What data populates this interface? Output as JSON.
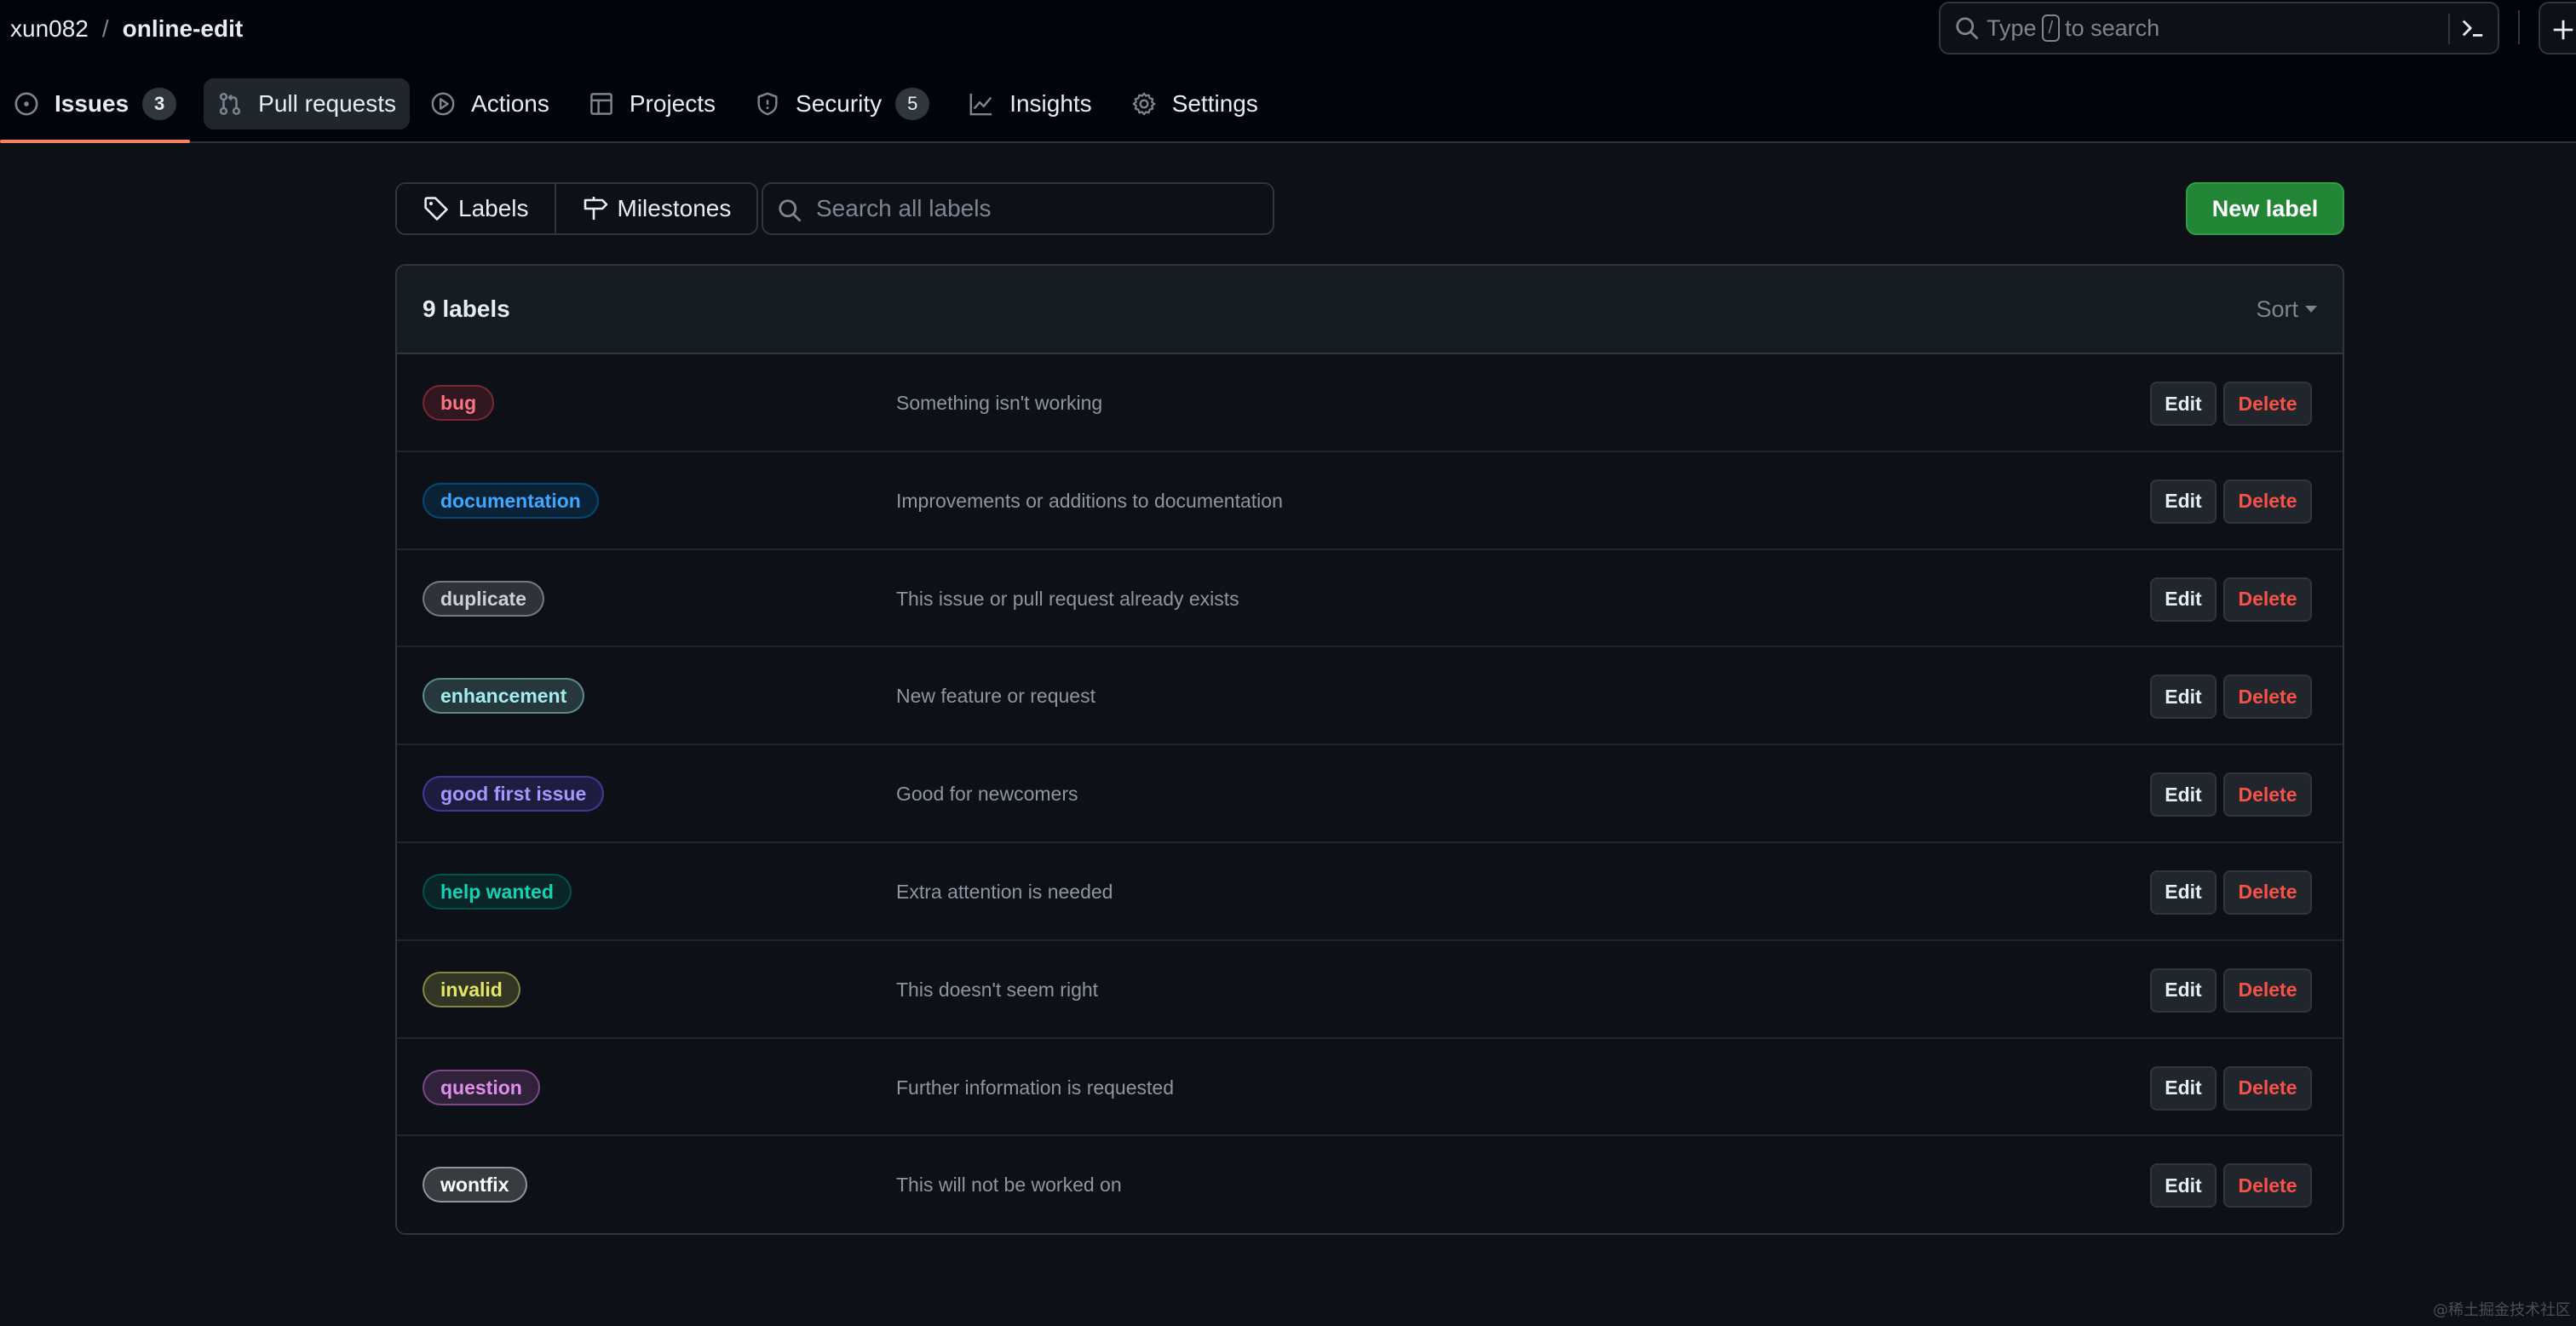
{
  "breadcrumb": {
    "owner": "xun082",
    "separator": "/",
    "repo": "online-edit"
  },
  "global_search": {
    "prefix": "Type",
    "key": "/",
    "suffix": "to search"
  },
  "tabs": [
    {
      "label": "Issues",
      "count": "3",
      "icon": "issue-opened-icon"
    },
    {
      "label": "Pull requests",
      "icon": "git-pull-request-icon"
    },
    {
      "label": "Actions",
      "icon": "play-icon"
    },
    {
      "label": "Projects",
      "icon": "table-icon"
    },
    {
      "label": "Security",
      "count": "5",
      "icon": "shield-icon"
    },
    {
      "label": "Insights",
      "icon": "graph-icon"
    },
    {
      "label": "Settings",
      "icon": "gear-icon"
    }
  ],
  "subnav": {
    "labels": "Labels",
    "milestones": "Milestones"
  },
  "label_search": {
    "placeholder": "Search all labels",
    "value": ""
  },
  "new_label_button": "New label",
  "list": {
    "count_text": "9 labels",
    "sort_label": "Sort",
    "edit_label": "Edit",
    "delete_label": "Delete",
    "labels": [
      {
        "name": "bug",
        "description": "Something isn't working",
        "color": "#d73a4a"
      },
      {
        "name": "documentation",
        "description": "Improvements or additions to documentation",
        "color": "#0075ca"
      },
      {
        "name": "duplicate",
        "description": "This issue or pull request already exists",
        "color": "#cfd3d7"
      },
      {
        "name": "enhancement",
        "description": "New feature or request",
        "color": "#a2eeef"
      },
      {
        "name": "good first issue",
        "description": "Good for newcomers",
        "color": "#7057ff"
      },
      {
        "name": "help wanted",
        "description": "Extra attention is needed",
        "color": "#008672"
      },
      {
        "name": "invalid",
        "description": "This doesn't seem right",
        "color": "#e4e669"
      },
      {
        "name": "question",
        "description": "Further information is requested",
        "color": "#d876e3"
      },
      {
        "name": "wontfix",
        "description": "This will not be worked on",
        "color": "#ffffff"
      }
    ]
  },
  "label_text_colors": [
    "#f97583",
    "#3fa7ff",
    "#c9d1d9",
    "#a2eeef",
    "#a697ff",
    "#14d3b4",
    "#e4e669",
    "#df8fea",
    "#ffffff"
  ],
  "watermark": "@稀土掘金技术社区"
}
